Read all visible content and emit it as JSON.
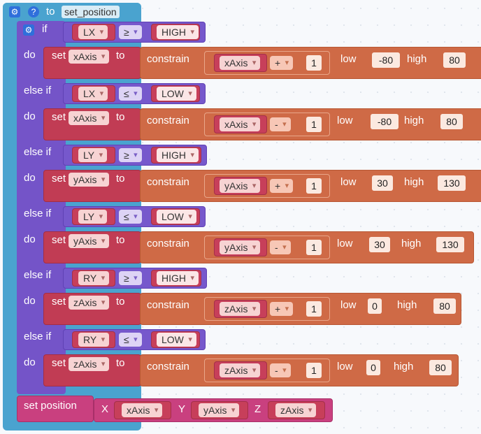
{
  "function": {
    "keyword": "to",
    "name": "set_position"
  },
  "icons": {
    "gear": "gear-icon",
    "help": "help-icon"
  },
  "labels": {
    "if": "if",
    "do": "do",
    "else_if": "else if",
    "set": "set",
    "to": "to",
    "constrain": "constrain",
    "low": "low",
    "high": "high",
    "set_position": "set position",
    "x": "X",
    "y": "Y",
    "z": "Z"
  },
  "branches": [
    {
      "cond_left": "LX",
      "cond_op": "≥",
      "cond_right": "HIGH",
      "target": "xAxis",
      "expr_var": "xAxis",
      "expr_op": "+",
      "expr_num": "1",
      "low": "-80",
      "high": "80"
    },
    {
      "cond_left": "LX",
      "cond_op": "≤",
      "cond_right": "LOW",
      "target": "xAxis",
      "expr_var": "xAxis",
      "expr_op": "-",
      "expr_num": "1",
      "low": "-80",
      "high": "80"
    },
    {
      "cond_left": "LY",
      "cond_op": "≥",
      "cond_right": "HIGH",
      "target": "yAxis",
      "expr_var": "yAxis",
      "expr_op": "+",
      "expr_num": "1",
      "low": "30",
      "high": "130"
    },
    {
      "cond_left": "LY",
      "cond_op": "≤",
      "cond_right": "LOW",
      "target": "yAxis",
      "expr_var": "yAxis",
      "expr_op": "-",
      "expr_num": "1",
      "low": "30",
      "high": "130"
    },
    {
      "cond_left": "RY",
      "cond_op": "≥",
      "cond_right": "HIGH",
      "target": "zAxis",
      "expr_var": "zAxis",
      "expr_op": "+",
      "expr_num": "1",
      "low": "0",
      "high": "80"
    },
    {
      "cond_left": "RY",
      "cond_op": "≤",
      "cond_right": "LOW",
      "target": "zAxis",
      "expr_var": "zAxis",
      "expr_op": "-",
      "expr_num": "1",
      "low": "0",
      "high": "80"
    }
  ],
  "set_position_call": {
    "x": "xAxis",
    "y": "yAxis",
    "z": "zAxis"
  }
}
